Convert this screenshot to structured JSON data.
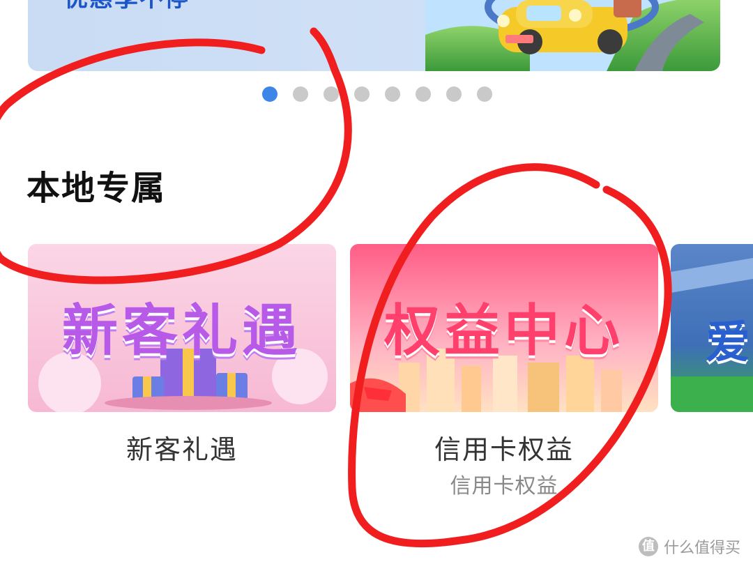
{
  "banner": {
    "title": "优惠享不停",
    "image": "yellow-car-illustration"
  },
  "carousel": {
    "total": 8,
    "active_index": 0
  },
  "section": {
    "title": "本地专属"
  },
  "cards": [
    {
      "image_text": "新客礼遇",
      "title": "新客礼遇",
      "subtitle": "",
      "image": "gift-boxes-banner"
    },
    {
      "image_text": "权益中心",
      "title": "信用卡权益",
      "subtitle": "信用卡权益",
      "image": "city-skyline-banner"
    },
    {
      "image_text": "爱",
      "title": "",
      "subtitle": "",
      "image": "stadium-banner-partial"
    }
  ],
  "watermark": {
    "logo_glyph": "值",
    "text": "什么值得买"
  },
  "colors": {
    "accent_blue": "#3d86e8",
    "annotation_red": "#f01e1e",
    "title_text": "#111111"
  }
}
